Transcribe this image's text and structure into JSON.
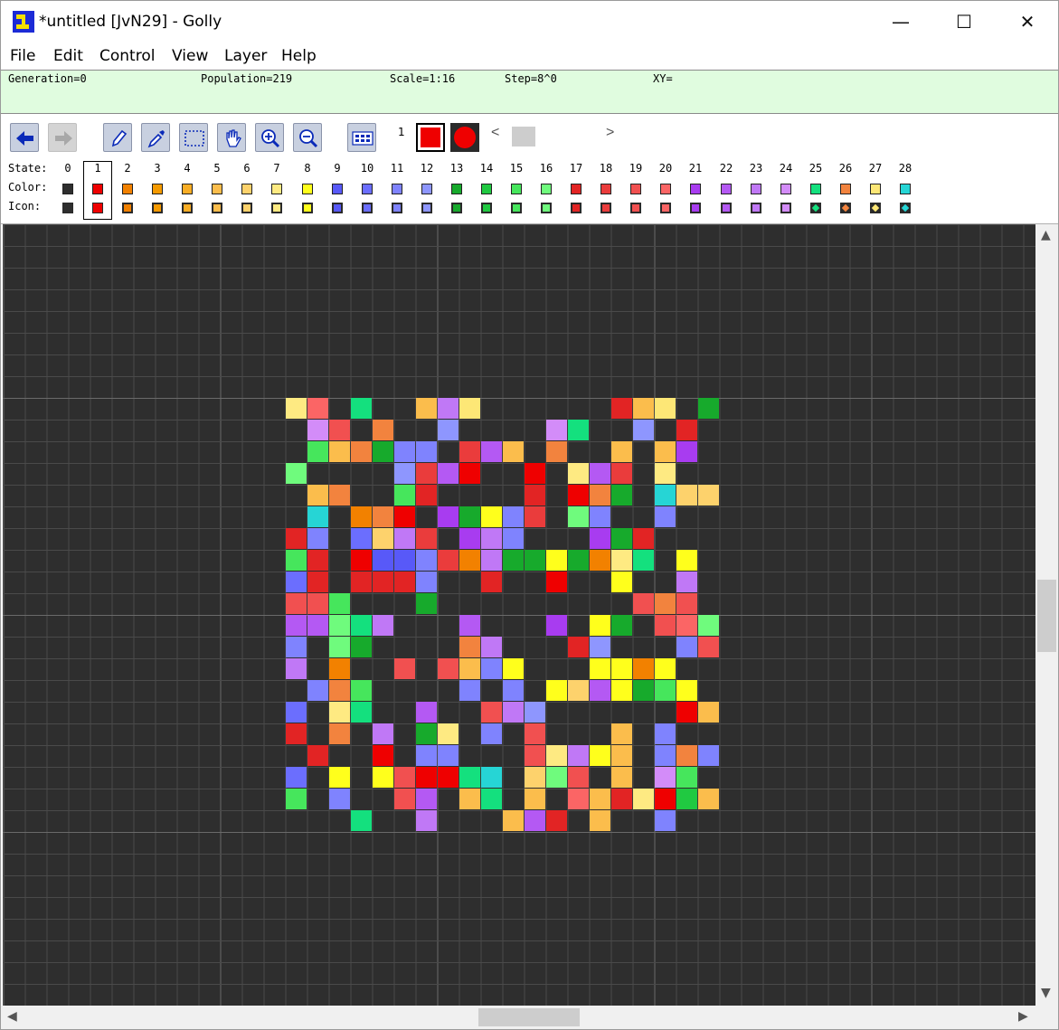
{
  "window": {
    "title": "*untitled [JvN29] - Golly",
    "minimize_glyph": "—",
    "maximize_glyph": "☐",
    "close_glyph": "✕"
  },
  "menu": [
    "File",
    "Edit",
    "Control",
    "View",
    "Layer",
    "Help"
  ],
  "status": {
    "generation": "Generation=0",
    "population": "Population=219",
    "scale": "Scale=1:16",
    "step": "Step=8^0",
    "xy": "XY="
  },
  "toolbar": {
    "tools": [
      {
        "name": "back-arrow-icon",
        "enabled": true
      },
      {
        "name": "forward-arrow-icon",
        "enabled": false
      },
      {
        "name": "pencil-icon",
        "enabled": true
      },
      {
        "name": "eyedropper-icon",
        "enabled": true
      },
      {
        "name": "select-icon",
        "enabled": true
      },
      {
        "name": "hand-icon",
        "enabled": true
      },
      {
        "name": "zoom-in-icon",
        "enabled": true
      },
      {
        "name": "zoom-out-icon",
        "enabled": true
      },
      {
        "name": "all-states-icon",
        "enabled": true
      }
    ],
    "current_state": "1",
    "current_color": "#ef0000",
    "slider_left": "<",
    "slider_right": ">"
  },
  "palette": {
    "state_label": "State:",
    "color_label": "Color:",
    "icon_label": "Icon:",
    "selected_state": 1,
    "states": [
      {
        "n": "0",
        "color": "#2e2e2e",
        "icon": "square"
      },
      {
        "n": "1",
        "color": "#ef0000",
        "icon": "square"
      },
      {
        "n": "2",
        "color": "#f28100",
        "icon": "cross"
      },
      {
        "n": "3",
        "color": "#f59a00",
        "icon": "cross"
      },
      {
        "n": "4",
        "color": "#f8ad25",
        "icon": "cross"
      },
      {
        "n": "5",
        "color": "#fbbd4c",
        "icon": "cross"
      },
      {
        "n": "6",
        "color": "#fdd26c",
        "icon": "cross"
      },
      {
        "n": "7",
        "color": "#feea82",
        "icon": "cross"
      },
      {
        "n": "8",
        "color": "#ffff1c",
        "icon": "cross"
      },
      {
        "n": "9",
        "color": "#5859f8",
        "icon": "right-arrow"
      },
      {
        "n": "10",
        "color": "#6b6efe",
        "icon": "up-arrow"
      },
      {
        "n": "11",
        "color": "#7f83fe",
        "icon": "left-arrow"
      },
      {
        "n": "12",
        "color": "#8e96fe",
        "icon": "down-arrow"
      },
      {
        "n": "13",
        "color": "#17aa2c",
        "icon": "right-arrow"
      },
      {
        "n": "14",
        "color": "#20c941",
        "icon": "up-arrow"
      },
      {
        "n": "15",
        "color": "#46e65c",
        "icon": "left-arrow"
      },
      {
        "n": "16",
        "color": "#6ffb7d",
        "icon": "down-arrow"
      },
      {
        "n": "17",
        "color": "#e22424",
        "icon": "right-arrow"
      },
      {
        "n": "18",
        "color": "#ea3c3c",
        "icon": "up-arrow"
      },
      {
        "n": "19",
        "color": "#f15050",
        "icon": "left-arrow"
      },
      {
        "n": "20",
        "color": "#fb6565",
        "icon": "down-arrow"
      },
      {
        "n": "21",
        "color": "#a83cf0",
        "icon": "right-arrow"
      },
      {
        "n": "22",
        "color": "#b459f3",
        "icon": "up-arrow"
      },
      {
        "n": "23",
        "color": "#c078f6",
        "icon": "left-arrow"
      },
      {
        "n": "24",
        "color": "#d38cf9",
        "icon": "down-arrow"
      },
      {
        "n": "25",
        "color": "#14e07e",
        "icon": "diamond"
      },
      {
        "n": "26",
        "color": "#f2833e",
        "icon": "diamond"
      },
      {
        "n": "27",
        "color": "#fde776",
        "icon": "diamond"
      },
      {
        "n": "28",
        "color": "#26d5d5",
        "icon": "diamond"
      }
    ]
  },
  "grid": {
    "background": "#2e2e2e",
    "cell_size_label": "Scale=1:16",
    "rows": [
      "7,20,,25,,,5,23,27,,,,,,,17,5,27,,13",
      ",24,19,,26,,,12,,,,,24,25,,,12,,17,",
      ",15,5,26,13,11,11,,18,22,5,,26,,,5,,5,21,",
      "16,,,,,12,18,22,1,,,1,,7,22,18,,7,,",
      ",5,26,,,15,17,,,,,17,,1,26,13,,28,6,6",
      ",28,,2,26,1,,21,13,8,11,18,,16,11,,,11,,",
      "17,11,,10,6,23,18,,21,23,11,,,,21,13,17,,,",
      "15,17,,1,9,9,11,18,2,23,13,13,8,13,2,7,25,,8,",
      "10,17,,17,17,17,11,,,17,,,1,,,8,,,23,",
      "19,19,15,,,,13,,,,,,,,,,19,26,19,",
      "22,22,16,25,23,,,,22,,,,21,,8,13,,19,20,16",
      "11,,16,13,,,,,26,23,,,,17,12,,,,11,19",
      "23,,2,,,19,,19,5,11,8,,,,8,8,2,8,,",
      ",11,26,15,,,,,11,,11,,8,6,22,8,13,15,8,",
      "10,,7,25,,,22,,,19,23,12,,,,,,,1,5",
      "17,,26,,23,,13,7,,11,,19,,,,5,,11,,",
      ",17,,,1,,11,11,,,,19,7,23,8,5,,11,26,11",
      "10,,8,,8,19,1,1,25,28,,6,16,19,,5,,24,15,",
      "15,,11,,,19,22,,5,25,,5,,20,5,17,7,1,14,5",
      ",,,25,,,23,,,,5,22,17,,5,,,11,,"
    ]
  }
}
